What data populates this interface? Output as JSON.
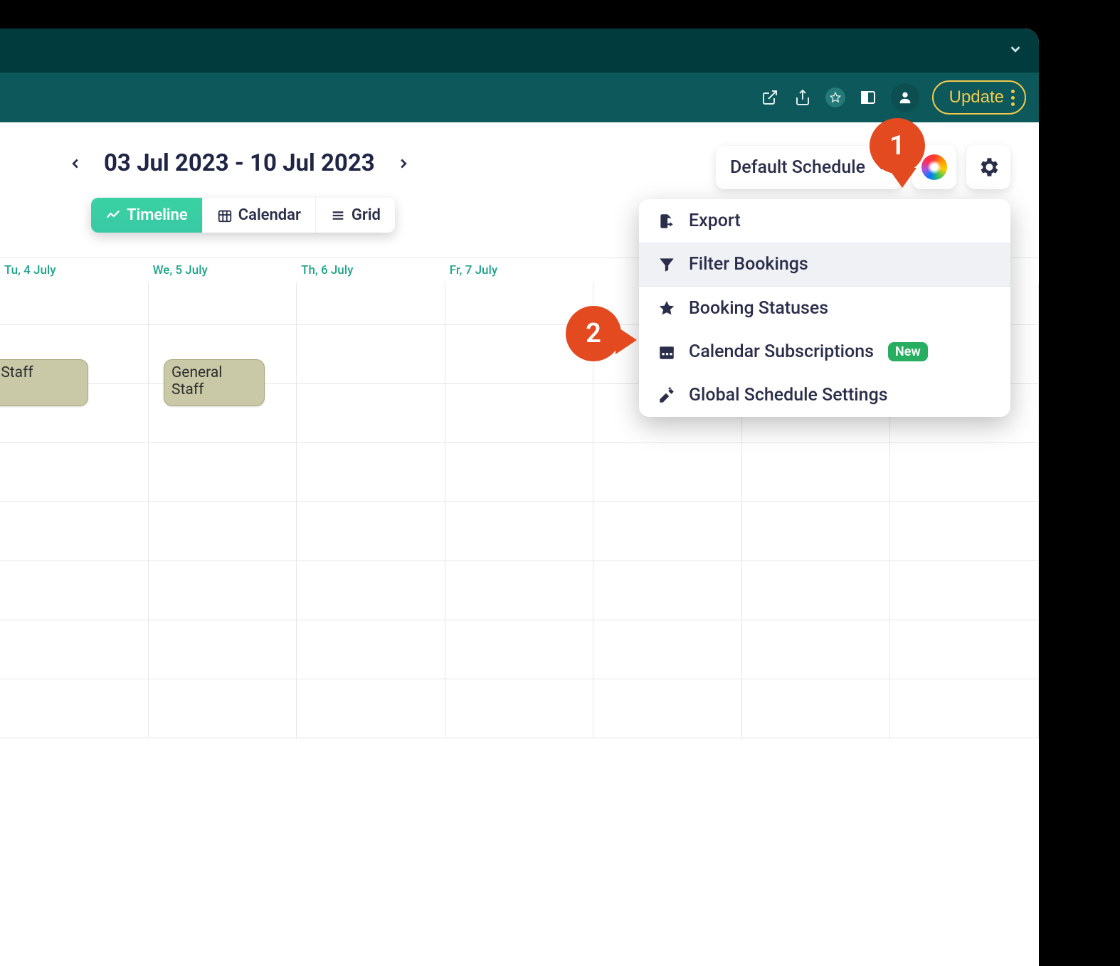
{
  "browser": {
    "update_label": "Update"
  },
  "app": {
    "date_range": "03 Jul 2023 - 10 Jul 2023",
    "view_tabs": {
      "timeline": "Timeline",
      "calendar": "Calendar",
      "grid": "Grid"
    },
    "schedule_selector": "Default Schedule",
    "settings_menu": {
      "export": "Export",
      "filter_bookings": "Filter Bookings",
      "booking_statuses": "Booking Statuses",
      "calendar_subscriptions": "Calendar Subscriptions",
      "calendar_subscriptions_badge": "New",
      "global_settings": "Global Schedule Settings"
    },
    "day_headers": [
      "Tu, 4 July",
      "We, 5 July",
      "Th, 6 July",
      "Fr, 7 July",
      "",
      "",
      ""
    ],
    "events": {
      "teaching_staff": "Teaching Staff",
      "general_staff": "General Staff"
    }
  },
  "callouts": {
    "one": "1",
    "two": "2"
  }
}
